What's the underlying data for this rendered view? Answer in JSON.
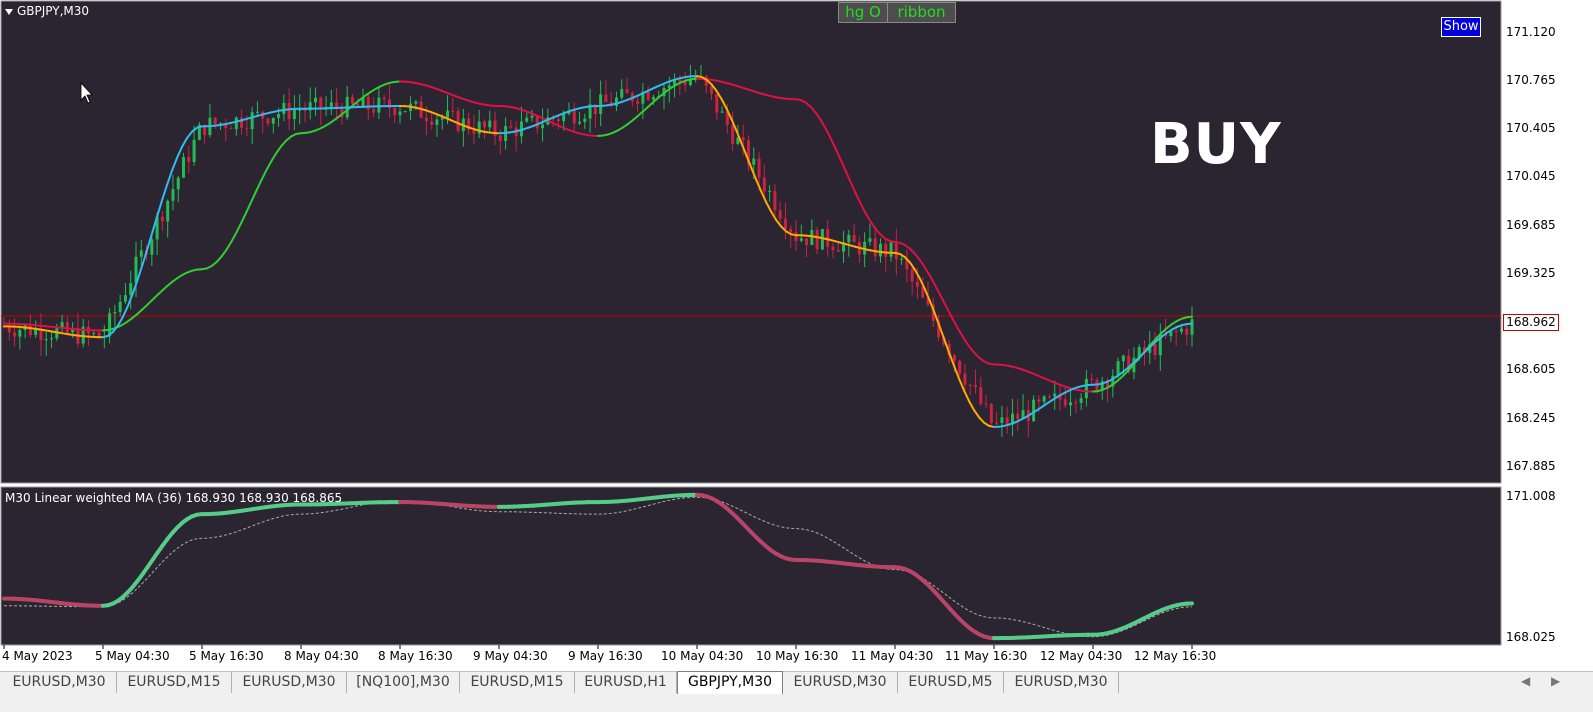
{
  "window": {
    "symbol_title": "GBPJPY,M30",
    "buttons": [
      "hg O",
      "ribbon"
    ],
    "show_button": "Show",
    "signal_label": "BUY",
    "current_price": "168.962"
  },
  "price_axis": [
    "171.120",
    "170.765",
    "170.405",
    "170.045",
    "169.685",
    "169.325",
    "168.605",
    "168.245",
    "167.885"
  ],
  "indicator": {
    "title": "M30   Linear weighted MA (36) 168.930 168.930 168.865",
    "axis_labels": [
      "171.008",
      "168.025"
    ]
  },
  "time_axis": [
    "4 May 2023",
    "5 May 04:30",
    "5 May 16:30",
    "8 May 04:30",
    "8 May 16:30",
    "9 May 04:30",
    "9 May 16:30",
    "10 May 04:30",
    "10 May 16:30",
    "11 May 04:30",
    "11 May 16:30",
    "12 May 04:30",
    "12 May 16:30"
  ],
  "tabs": [
    {
      "label": "EURUSD,M30",
      "active": false
    },
    {
      "label": "EURUSD,M15",
      "active": false
    },
    {
      "label": "EURUSD,M30",
      "active": false
    },
    {
      "label": "[NQ100],M30",
      "active": false
    },
    {
      "label": "EURUSD,M15",
      "active": false
    },
    {
      "label": "EURUSD,H1",
      "active": false
    },
    {
      "label": "GBPJPY,M30",
      "active": true
    },
    {
      "label": "EURUSD,M30",
      "active": false
    },
    {
      "label": "EURUSD,M5",
      "active": false
    },
    {
      "label": "EURUSD,M30",
      "active": false
    }
  ],
  "colors": {
    "chart_bg": "#2a2530",
    "bull": "#22bb55",
    "bear": "#cc2244",
    "ma_fast_up": "#33bbee",
    "ma_fast_down": "#ffaa00",
    "ma_slow_up": "#33cc33",
    "ma_slow_down": "#dd1144",
    "current_price_line": "#cc0000"
  },
  "chart_data": [
    {
      "type": "line",
      "title": "",
      "x": [
        "4 May 2023",
        "5 May 04:30",
        "5 May 16:30",
        "8 May 04:30",
        "8 May 16:30",
        "9 May 04:30",
        "9 May 16:30",
        "10 May 04:30",
        "10 May 16:30",
        "11 May 04:30",
        "11 May 16:30",
        "12 May 04:30",
        "12 May 16:30"
      ],
      "series": [
        {
          "values": [
            168.88,
            168.8,
            170.35,
            170.48,
            170.5,
            170.3,
            170.5,
            170.72,
            169.55,
            169.42,
            168.14,
            168.45,
            168.9
          ]
        },
        {
          "values": [
            168.9,
            168.85,
            169.3,
            170.3,
            170.68,
            170.5,
            170.28,
            170.7,
            170.55,
            169.5,
            168.6,
            168.4,
            168.95
          ]
        }
      ],
      "ylim": [
        167.75,
        171.25
      ],
      "current_price": 168.962
    },
    {
      "type": "line",
      "title": "Linear weighted MA (36)",
      "x": [
        "4 May 2023",
        "5 May 04:30",
        "5 May 16:30",
        "8 May 04:30",
        "8 May 16:30",
        "9 May 04:30",
        "9 May 16:30",
        "10 May 04:30",
        "10 May 16:30",
        "11 May 04:30",
        "11 May 16:30",
        "12 May 04:30",
        "12 May 16:30"
      ],
      "series": [
        {
          "values": [
            168.85,
            168.7,
            170.6,
            170.8,
            170.85,
            170.75,
            170.85,
            171.0,
            169.65,
            169.5,
            168.03,
            168.1,
            168.75
          ]
        },
        {
          "values": [
            168.7,
            168.68,
            170.1,
            170.6,
            170.88,
            170.65,
            170.6,
            170.95,
            170.3,
            169.45,
            168.45,
            168.06,
            168.68
          ]
        }
      ],
      "ylim": [
        167.95,
        171.1
      ]
    }
  ]
}
